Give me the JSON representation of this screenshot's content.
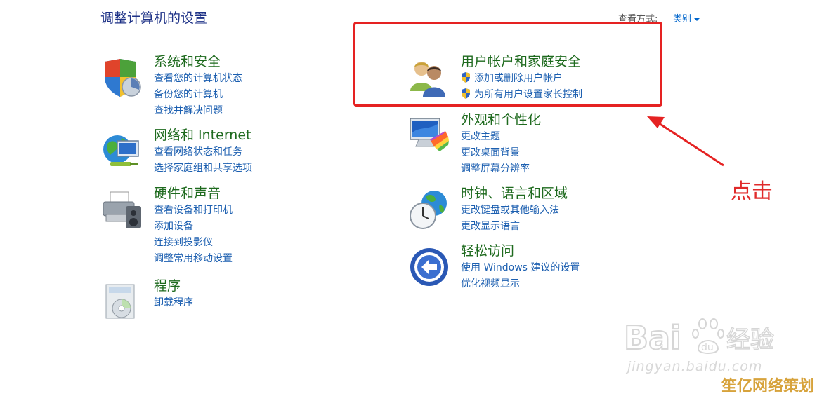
{
  "header": {
    "title": "调整计算机的设置",
    "view_label": "查看方式:",
    "view_value": "类别"
  },
  "categories": {
    "system": {
      "title": "系统和安全",
      "links": [
        "查看您的计算机状态",
        "备份您的计算机",
        "查找并解决问题"
      ]
    },
    "network": {
      "title": "网络和 Internet",
      "links": [
        "查看网络状态和任务",
        "选择家庭组和共享选项"
      ]
    },
    "hardware": {
      "title": "硬件和声音",
      "links": [
        "查看设备和打印机",
        "添加设备",
        "连接到投影仪",
        "调整常用移动设置"
      ]
    },
    "programs": {
      "title": "程序",
      "links": [
        "卸载程序"
      ]
    },
    "accounts": {
      "title": "用户帐户和家庭安全",
      "links": [
        "添加或删除用户帐户",
        "为所有用户设置家长控制"
      ]
    },
    "appearance": {
      "title": "外观和个性化",
      "links": [
        "更改主题",
        "更改桌面背景",
        "调整屏幕分辨率"
      ]
    },
    "clock": {
      "title": "时钟、语言和区域",
      "links": [
        "更改键盘或其他输入法",
        "更改显示语言"
      ]
    },
    "ease": {
      "title": "轻松访问",
      "links": [
        "使用 Windows 建议的设置",
        "优化视频显示"
      ]
    }
  },
  "annotation": {
    "text": "点击",
    "color": "#e52222"
  },
  "watermark": {
    "baidu_text": "Bai",
    "baidu_suffix": "du",
    "jingyan": "经验",
    "url": "jingyan.baidu.com",
    "site": "笙亿网络策划"
  }
}
